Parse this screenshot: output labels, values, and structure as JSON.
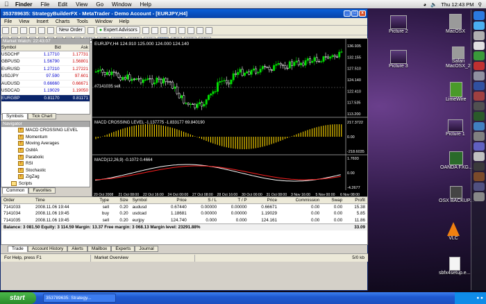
{
  "mac_menubar": {
    "items": [
      "Finder",
      "File",
      "Edit",
      "View",
      "Go",
      "Window",
      "Help"
    ],
    "clock": "Thu 12:43 PM"
  },
  "window": {
    "title": "353789635: StrategyBuilderFX - MetaTrader - Demo Account - [EURJPY,H4]",
    "menus": [
      "File",
      "View",
      "Insert",
      "Charts",
      "Tools",
      "Window",
      "Help"
    ],
    "toolbar": {
      "new_order": "New Order",
      "expert_advisors": "Expert Advisors",
      "timeframes": [
        "M1",
        "M5",
        "M15",
        "M30",
        "H1",
        "H4",
        "D1",
        "W1",
        "MN"
      ],
      "active_timeframe": "H4"
    }
  },
  "market_watch": {
    "header": "Market Watch: 22:43:07",
    "columns": [
      "Symbol",
      "Bid",
      "Ask"
    ],
    "rows": [
      {
        "symbol": "USDCHF",
        "bid": "1.17710",
        "ask": "1.17731"
      },
      {
        "symbol": "GBPUSD",
        "bid": "1.56790",
        "ask": "1.56801"
      },
      {
        "symbol": "EURUSD",
        "bid": "1.27210",
        "ask": "1.27221"
      },
      {
        "symbol": "USDJPY",
        "bid": "97.590",
        "ask": "97.601"
      },
      {
        "symbol": "AUDUSD",
        "bid": "0.66660",
        "ask": "0.66671"
      },
      {
        "symbol": "USDCAD",
        "bid": "1.19029",
        "ask": "1.19050"
      },
      {
        "symbol": "EURGBP",
        "bid": "0.81170",
        "ask": "0.81171"
      }
    ],
    "tabs": [
      "Symbols",
      "Tick Chart"
    ]
  },
  "navigator": {
    "header": "Navigator",
    "items": [
      "MACD CROSSING LEVEL",
      "Momentum",
      "Moving Averages",
      "OsMA",
      "Parabolic",
      "RSI",
      "Stochastic",
      "ZigZag",
      "Scripts"
    ],
    "tabs": [
      "Common",
      "Favorites"
    ]
  },
  "chart": {
    "symbol_label": "EURJPY,H4  124.910 125.000 124.000 124.140",
    "order_label": "#7141035 sell",
    "price_ticks": [
      "136.935",
      "132.155",
      "127.510",
      "124.140",
      "122.410",
      "117.535",
      "113.200"
    ],
    "current_price": "124.140",
    "macd_cross_label": "MACD CROSSING LEVEL -1.137775 -1.833177 69.840190",
    "macd_cross_ticks": [
      "217.3722",
      "0.00",
      "-218.6035"
    ],
    "macd_label": "MACD(12,26,9) -0.1072 0.4664",
    "macd_ticks": [
      "1.7693",
      "0.00",
      "-4.2677"
    ],
    "date_ticks": [
      "20 Oct 2008",
      "21 Oct 08:00",
      "22 Oct 16:00",
      "24 Oct 00:00",
      "27 Oct 08:00",
      "28 Oct 16:00",
      "30 Oct 00:00",
      "31 Oct 08:00",
      "3 Nov 16:00",
      "5 Nov 00:00",
      "6 Nov 08:00"
    ]
  },
  "terminal": {
    "columns": [
      "Order",
      "Time",
      "Type",
      "Size",
      "Symbol",
      "Price",
      "S / L",
      "T / P",
      "Price",
      "Commission",
      "Swap",
      "Profit"
    ],
    "rows": [
      [
        "7141033",
        "2008.11.06 19:44",
        "sell",
        "0.20",
        "audusd",
        "0.67440",
        "0.00000",
        "0.00000",
        "0.66671",
        "0.00",
        "0.00",
        "15.38"
      ],
      [
        "7141034",
        "2008.11.06 19:45",
        "buy",
        "0.20",
        "usdcad",
        "1.18681",
        "0.00000",
        "0.00000",
        "1.19029",
        "0.00",
        "0.00",
        "5.85"
      ],
      [
        "7141035",
        "2008.11.06 19:45",
        "sell",
        "0.20",
        "eurjpy",
        "124.740",
        "0.000",
        "0.000",
        "124.161",
        "0.00",
        "0.00",
        "11.86"
      ]
    ],
    "balance_line": "Balance: 3 081.50  Equity: 3 114.59  Margin: 13.37  Free margin: 3 068.13  Margin level: 23291.88%",
    "total_profit": "33.09",
    "tabs": [
      "Trade",
      "Account History",
      "Alerts",
      "Mailbox",
      "Experts",
      "Journal"
    ]
  },
  "statusbar": {
    "help": "For Help, press F1",
    "profile": "Market Overview",
    "traffic": "5/0 kb"
  },
  "desktop_icons": [
    "Picture 2",
    "Picture 3",
    "MacOSX",
    "Safari",
    "MacOSX_2",
    "LimeWire",
    "Picture 1",
    "OANDA FXG...",
    "OSX BACKUP...",
    "VLC",
    "sbfx4setup.e..."
  ],
  "taskbar": {
    "start": "start",
    "task": "353789635: Strategy..."
  },
  "colors": {
    "bull_candle": "#00e000",
    "bear_candle": "#ffffff",
    "indicator_histogram": "#ffd800",
    "macd_main": "#ffffff",
    "macd_signal": "#ff2020"
  }
}
